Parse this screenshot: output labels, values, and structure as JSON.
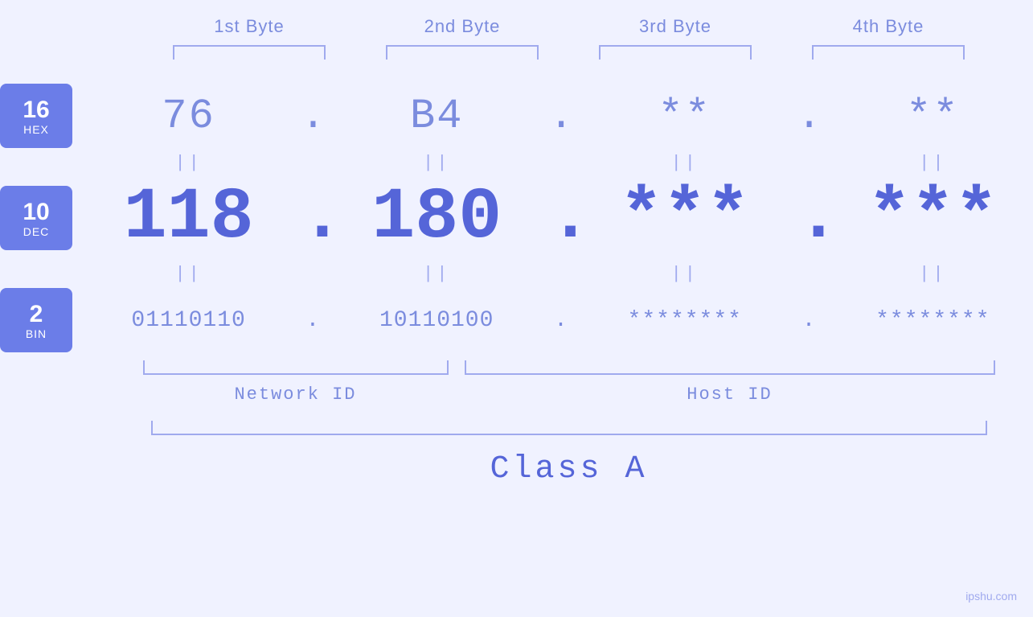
{
  "bytes": {
    "headers": [
      "1st Byte",
      "2nd Byte",
      "3rd Byte",
      "4th Byte"
    ]
  },
  "bases": [
    {
      "number": "16",
      "label": "HEX"
    },
    {
      "number": "10",
      "label": "DEC"
    },
    {
      "number": "2",
      "label": "BIN"
    }
  ],
  "hex_row": {
    "values": [
      "76",
      "B4",
      "**",
      "**"
    ],
    "dots": [
      ".",
      ".",
      ".",
      ""
    ]
  },
  "dec_row": {
    "values": [
      "118",
      "180",
      "***",
      "***"
    ],
    "dots": [
      ".",
      ".",
      ".",
      ""
    ]
  },
  "bin_row": {
    "values": [
      "01110110",
      "10110100",
      "********",
      "********"
    ],
    "dots": [
      ".",
      ".",
      ".",
      ""
    ]
  },
  "labels": {
    "network_id": "Network ID",
    "host_id": "Host ID",
    "class": "Class A"
  },
  "watermark": "ipshu.com"
}
